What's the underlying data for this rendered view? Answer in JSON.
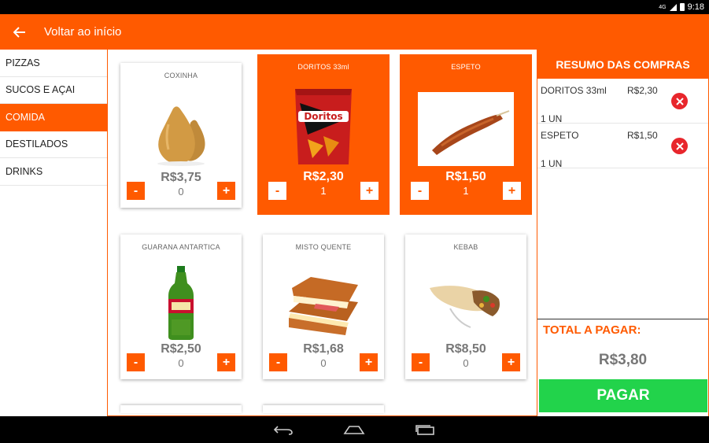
{
  "status_bar": {
    "network": "4G",
    "time": "9:18"
  },
  "header": {
    "title": "Voltar ao início"
  },
  "sidebar": {
    "items": [
      {
        "label": "PIZZAS",
        "active": false
      },
      {
        "label": "SUCOS E AÇAI",
        "active": false
      },
      {
        "label": "COMIDA",
        "active": true
      },
      {
        "label": "DESTILADOS",
        "active": false
      },
      {
        "label": "DRINKS",
        "active": false
      }
    ]
  },
  "products": [
    {
      "name": "COXINHA",
      "price": "R$3,75",
      "qty": "0",
      "selected": false
    },
    {
      "name": "DORITOS 33ml",
      "price": "R$2,30",
      "qty": "1",
      "selected": true
    },
    {
      "name": "ESPETO",
      "price": "R$1,50",
      "qty": "1",
      "selected": true
    },
    {
      "name": "GUARANA ANTARTICA",
      "price": "R$2,50",
      "qty": "0",
      "selected": false
    },
    {
      "name": "MISTO QUENTE",
      "price": "R$1,68",
      "qty": "0",
      "selected": false
    },
    {
      "name": "KEBAB",
      "price": "R$8,50",
      "qty": "0",
      "selected": false
    }
  ],
  "controls": {
    "minus": "-",
    "plus": "+"
  },
  "summary": {
    "title": "RESUMO DAS COMPRAS",
    "items": [
      {
        "name": "DORITOS 33ml",
        "price": "R$2,30",
        "units": "1 UN"
      },
      {
        "name": "ESPETO",
        "price": "R$1,50",
        "units": "1 UN"
      }
    ],
    "total_label": "TOTAL A PAGAR:",
    "total_value": "R$3,80",
    "pay_label": "PAGAR"
  },
  "colors": {
    "accent": "#ff5a00",
    "pay": "#22d34b",
    "remove": "#e8262c"
  },
  "icons": {
    "back": "arrow-left-icon",
    "remove": "close-circle-icon",
    "nav": [
      "back-nav-icon",
      "home-nav-icon",
      "recents-nav-icon"
    ]
  }
}
